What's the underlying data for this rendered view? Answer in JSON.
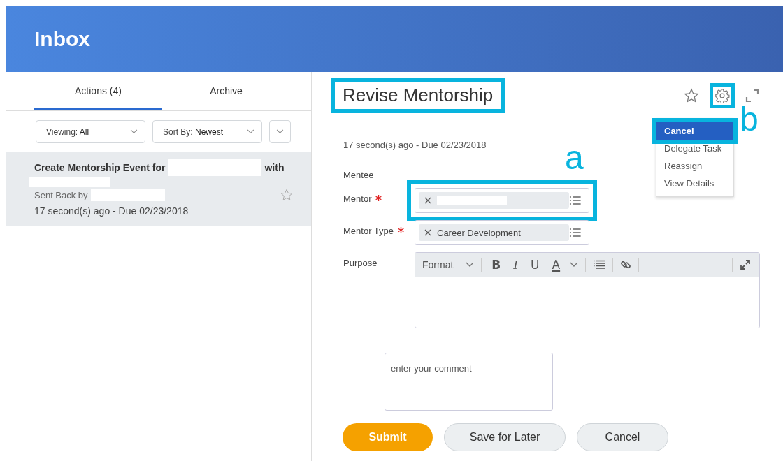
{
  "header": {
    "title": "Inbox"
  },
  "tabs": [
    {
      "label": "Actions (4)",
      "selected": true
    },
    {
      "label": "Archive",
      "selected": false
    }
  ],
  "filters": [
    {
      "label": "Viewing:",
      "value": "All"
    },
    {
      "label": "Sort By:",
      "value": "Newest"
    }
  ],
  "inbox_items": [
    {
      "title_start": "Create Mentorship Event for",
      "title_joiner": "with",
      "sent_back": "Sent Back by",
      "due": "17 second(s) ago - Due 02/23/2018",
      "selected": true
    }
  ],
  "task": {
    "title": "Revise Mentorship",
    "highlighted": true,
    "due": "17 second(s) ago - Due 02/23/2018",
    "fields": [
      {
        "label": "Mentee",
        "kind": "empty"
      },
      {
        "label": "Mentor",
        "required": true,
        "kind": "prompt",
        "highlighted": true,
        "chip": {
          "kind": "redacted"
        }
      },
      {
        "label": "Mentor Type",
        "required": true,
        "kind": "prompt",
        "chip": {
          "kind": "text",
          "text": "Career Development"
        }
      },
      {
        "label": "Purpose",
        "kind": "rich_text"
      }
    ],
    "editor_toolbar": {
      "format": "Format",
      "buttons": [
        {
          "text": "B",
          "kind": "bold"
        },
        {
          "text": "I",
          "kind": "italic"
        },
        {
          "text": "U",
          "kind": "underline"
        },
        {
          "text": "A",
          "kind": "color"
        }
      ]
    },
    "comment": {
      "placeholder": "enter your comment"
    }
  },
  "actions_menu": {
    "open": true,
    "gear_highlighted": true,
    "items": [
      {
        "label": "Cancel",
        "selected": true,
        "highlighted": true
      },
      {
        "label": "Delegate Task",
        "selected": false,
        "highlighted": false
      },
      {
        "label": "Reassign",
        "selected": false,
        "highlighted": false
      },
      {
        "label": "View Details",
        "selected": false,
        "highlighted": false
      }
    ]
  },
  "buttons": [
    {
      "label": "Submit",
      "kind": "primary"
    },
    {
      "label": "Save for Later",
      "kind": "secondary"
    },
    {
      "label": "Cancel",
      "kind": "secondary"
    }
  ],
  "annotations": [
    {
      "label": "a"
    },
    {
      "label": "b"
    }
  ]
}
